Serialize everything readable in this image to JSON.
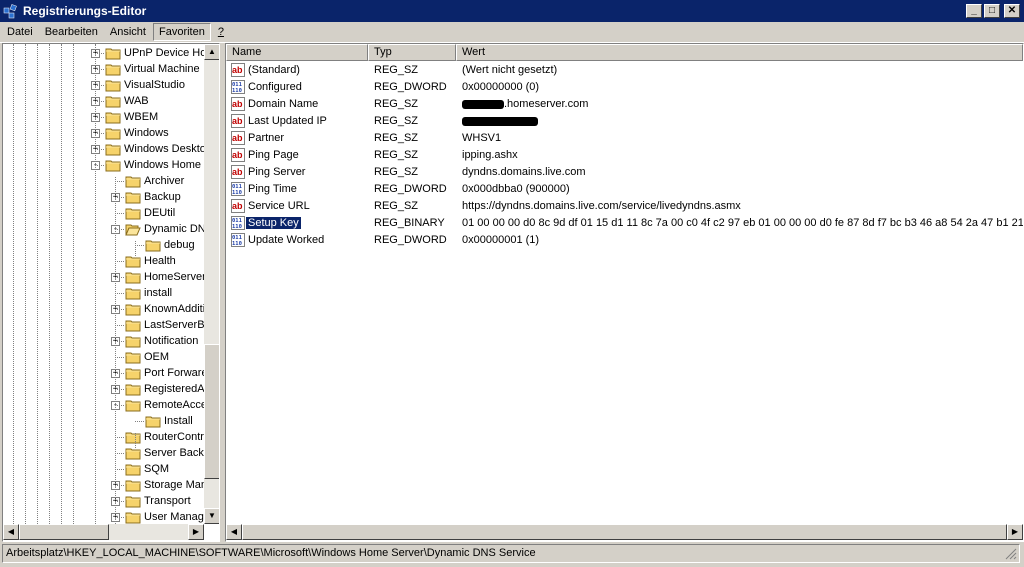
{
  "window": {
    "title": "Registrierungs-Editor",
    "buttons": {
      "minimize": "_",
      "maximize": "□",
      "close": "✕"
    }
  },
  "menu": [
    {
      "label": "Datei"
    },
    {
      "label": "Bearbeiten"
    },
    {
      "label": "Ansicht"
    },
    {
      "label": "Favoriten",
      "active": true
    },
    {
      "label": "?"
    }
  ],
  "tree": [
    {
      "label": "UPnP Device Ho",
      "level": 0,
      "expander": "+"
    },
    {
      "label": "Virtual Machine",
      "level": 0,
      "expander": "+"
    },
    {
      "label": "VisualStudio",
      "level": 0,
      "expander": "+"
    },
    {
      "label": "WAB",
      "level": 0,
      "expander": "+"
    },
    {
      "label": "WBEM",
      "level": 0,
      "expander": "+"
    },
    {
      "label": "Windows",
      "level": 0,
      "expander": "+"
    },
    {
      "label": "Windows Deskto",
      "level": 0,
      "expander": "+"
    },
    {
      "label": "Windows Home S",
      "level": 0,
      "expander": "-"
    },
    {
      "label": "Archiver",
      "level": 1,
      "expander": ""
    },
    {
      "label": "Backup",
      "level": 1,
      "expander": "+"
    },
    {
      "label": "DEUtil",
      "level": 1,
      "expander": ""
    },
    {
      "label": "Dynamic DN",
      "level": 1,
      "expander": "-",
      "open": true
    },
    {
      "label": "debug",
      "level": 2,
      "expander": ""
    },
    {
      "label": "Health",
      "level": 1,
      "expander": ""
    },
    {
      "label": "HomeServer",
      "level": 1,
      "expander": "+"
    },
    {
      "label": "install",
      "level": 1,
      "expander": ""
    },
    {
      "label": "KnownAdditi",
      "level": 1,
      "expander": "+"
    },
    {
      "label": "LastServerB",
      "level": 1,
      "expander": ""
    },
    {
      "label": "Notification",
      "level": 1,
      "expander": "+"
    },
    {
      "label": "OEM",
      "level": 1,
      "expander": ""
    },
    {
      "label": "Port Forware",
      "level": 1,
      "expander": "+"
    },
    {
      "label": "RegisteredA",
      "level": 1,
      "expander": "+"
    },
    {
      "label": "RemoteAcce",
      "level": 1,
      "expander": "-"
    },
    {
      "label": "Install",
      "level": 2,
      "expander": ""
    },
    {
      "label": "RouterContr",
      "level": 1,
      "expander": ""
    },
    {
      "label": "Server Backu",
      "level": 1,
      "expander": ""
    },
    {
      "label": "SQM",
      "level": 1,
      "expander": ""
    },
    {
      "label": "Storage Man",
      "level": 1,
      "expander": "+"
    },
    {
      "label": "Transport",
      "level": 1,
      "expander": "+"
    },
    {
      "label": "User Manage",
      "level": 1,
      "expander": "+"
    }
  ],
  "list": {
    "columns": [
      "Name",
      "Typ",
      "Wert"
    ],
    "rows": [
      {
        "name": "(Standard)",
        "type": "REG_SZ",
        "value": "(Wert nicht gesetzt)",
        "icon": "string-value-icon"
      },
      {
        "name": "Configured",
        "type": "REG_DWORD",
        "value": "0x00000000 (0)",
        "icon": "binary-value-icon"
      },
      {
        "name": "Domain Name",
        "type": "REG_SZ",
        "value": ".homeserver.com",
        "redacted_prefix": true,
        "icon": "string-value-icon"
      },
      {
        "name": "Last Updated IP",
        "type": "REG_SZ",
        "value": "",
        "redacted_full": true,
        "icon": "string-value-icon"
      },
      {
        "name": "Partner",
        "type": "REG_SZ",
        "value": "WHSV1",
        "icon": "string-value-icon"
      },
      {
        "name": "Ping Page",
        "type": "REG_SZ",
        "value": "ipping.ashx",
        "icon": "string-value-icon"
      },
      {
        "name": "Ping Server",
        "type": "REG_SZ",
        "value": "dyndns.domains.live.com",
        "icon": "string-value-icon"
      },
      {
        "name": "Ping Time",
        "type": "REG_DWORD",
        "value": "0x000dbba0 (900000)",
        "icon": "binary-value-icon"
      },
      {
        "name": "Service URL",
        "type": "REG_SZ",
        "value": "https://dyndns.domains.live.com/service/livedyndns.asmx",
        "icon": "string-value-icon"
      },
      {
        "name": "Setup Key",
        "type": "REG_BINARY",
        "value": "01 00 00 00 d0 8c 9d df 01 15 d1 11 8c 7a 00 c0 4f c2 97 eb 01 00 00 00 d0 fe 87 8d f7 bc b3 46 a8 54 2a 47 b1 21",
        "icon": "binary-value-icon",
        "selected": true
      },
      {
        "name": "Update Worked",
        "type": "REG_DWORD",
        "value": "0x00000001 (1)",
        "icon": "binary-value-icon"
      }
    ]
  },
  "status": "Arbeitsplatz\\HKEY_LOCAL_MACHINE\\SOFTWARE\\Microsoft\\Windows Home Server\\Dynamic DNS Service",
  "colors": {
    "titlebar": "#0a246a",
    "selection": "#0a246a",
    "folder": "#f6d36b"
  }
}
